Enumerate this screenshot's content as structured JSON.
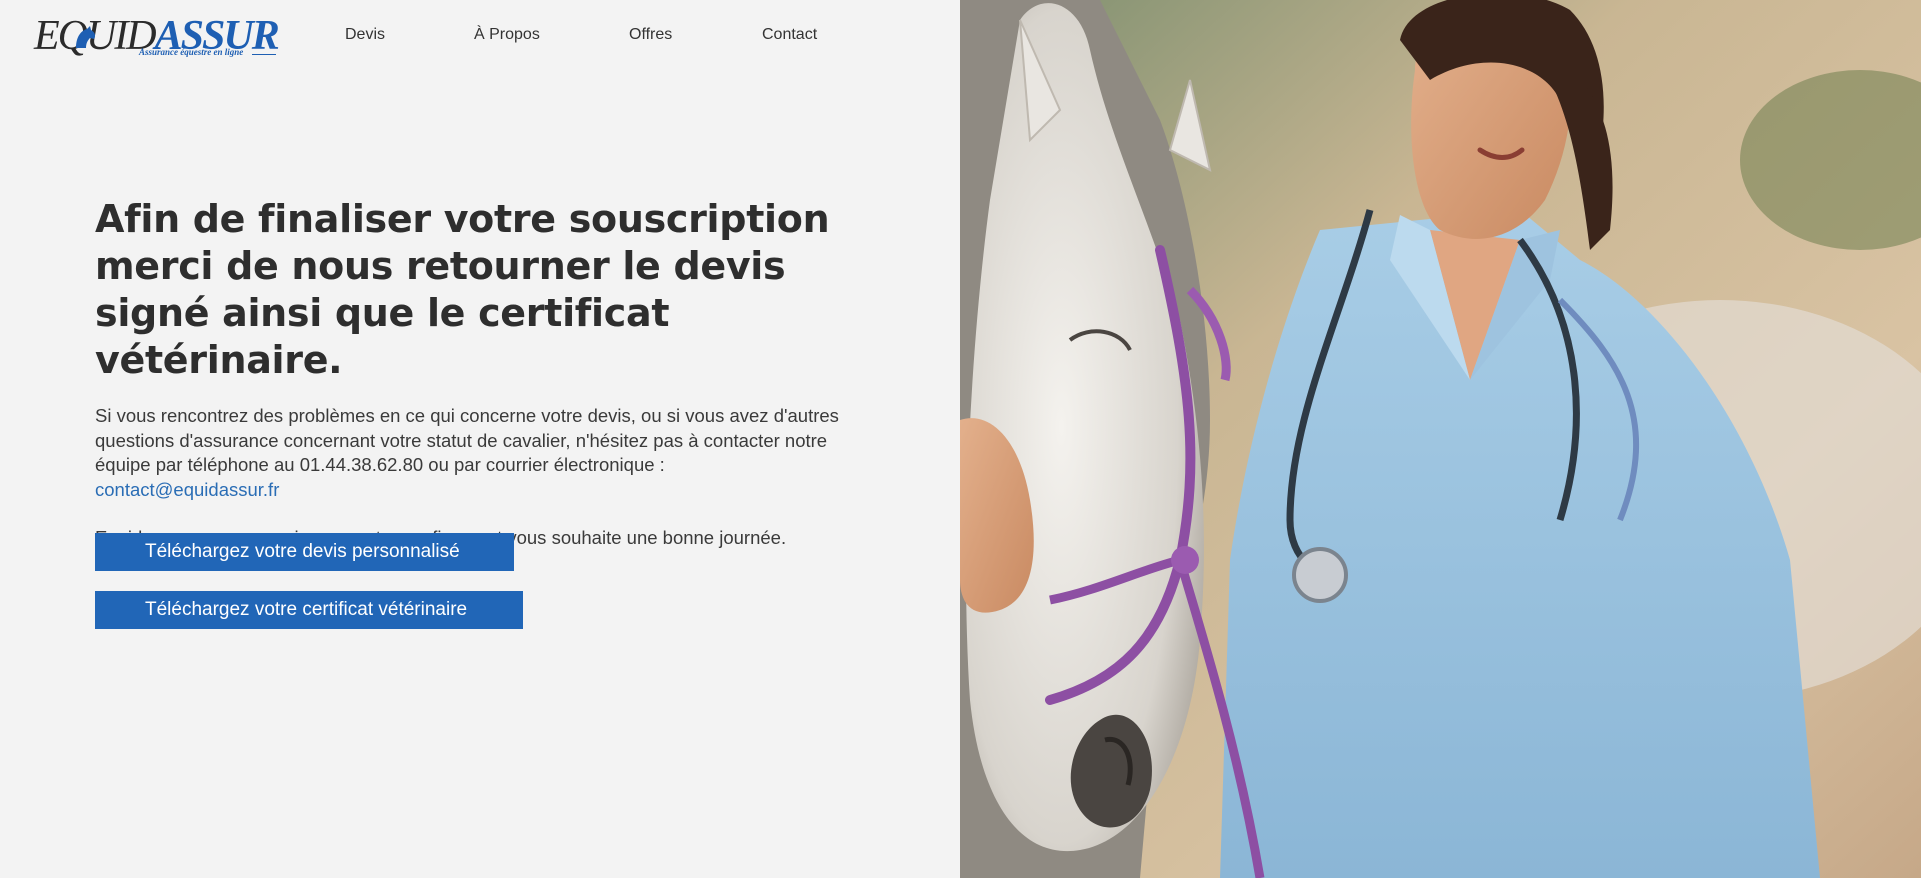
{
  "brand": {
    "name_part1": "EQUID",
    "name_part2": "ASSUR",
    "tagline": "Assurance équestre en ligne",
    "logo_icon": "horse-head-icon",
    "colors": {
      "blue": "#1e5fb3",
      "dark": "#2b2b2b"
    }
  },
  "nav": {
    "items": [
      {
        "label": "Devis"
      },
      {
        "label": "À Propos"
      },
      {
        "label": "Offres"
      },
      {
        "label": "Contact"
      }
    ]
  },
  "main": {
    "headline": "Afin de finaliser votre souscription merci de nous retourner le devis signé ainsi que le certificat vétérinaire.",
    "paragraph": "Si vous rencontrez des problèmes en ce qui concerne votre devis, ou si vous avez d'autres questions d'assurance concernant votre statut de cavalier, n'hésitez pas à contacter notre équipe par téléphone au 01.44.38.62.80 ou par courrier électronique :",
    "email": "contact@equidassur.fr",
    "thanks": "Equidassur vous remercie pour votre confiance et vous souhaite une bonne journée.",
    "buttons": {
      "devis": "Téléchargez votre devis personnalisé",
      "certificat": "Téléchargez votre certificat vétérinaire"
    },
    "button_color": "#2166b7",
    "link_color": "#2a6db5"
  },
  "hero_image": {
    "subject": "veterinarian-with-horse-photo"
  }
}
